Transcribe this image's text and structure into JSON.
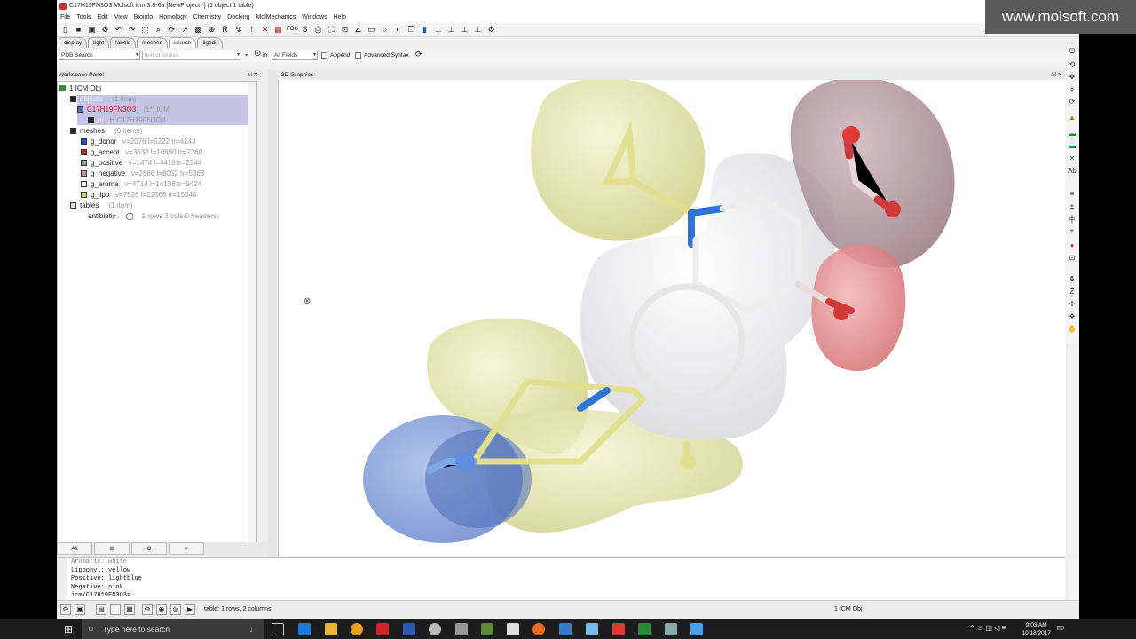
{
  "window": {
    "title": "C17H19FN3O3 Molsoft icm 3.8-6a [NewProject *] (1 object 1 table)",
    "watermark": "www.molsoft.com"
  },
  "menu": [
    "File",
    "Tools",
    "Edit",
    "View",
    "Bioinfo",
    "Homology",
    "Chemistry",
    "Docking",
    "MolMechanics",
    "Windows",
    "Help"
  ],
  "tabs": [
    "display",
    "light",
    "labels",
    "meshes",
    "search",
    "ligedit"
  ],
  "active_tab": "search",
  "search": {
    "database": "PDB Search",
    "placeholder": "text or smiles",
    "in_label": "in",
    "field": "All Fields",
    "append_label": "Append",
    "advanced_label": "Advanced Syntax"
  },
  "workspace": {
    "title": "Workspace Panel",
    "root": "1 ICM Obj",
    "objects_label": "objects",
    "objects_count": "(1 item)",
    "molecule": "C17H19FN3O3",
    "molecule_tag": "[1*] ICM",
    "chain": "m",
    "chain_tag": "H  C17H19FN3O3",
    "meshes_label": "meshes",
    "meshes_count": "(6 items)",
    "meshes": [
      {
        "name": "g_donor",
        "info": "v=2076 l=6222 tr=4148",
        "color": "#2a52be"
      },
      {
        "name": "g_accept",
        "info": "v=3632 l=10890 tr=7260",
        "color": "#d01c1c"
      },
      {
        "name": "g_positive",
        "info": "v=1474 l=4410 tr=2944",
        "color": "#8e9dc4"
      },
      {
        "name": "g_negative",
        "info": "v=2686 l=8052 tr=5368",
        "color": "#c48e9d"
      },
      {
        "name": "g_aroma",
        "info": "v=4714 l=14136 tr=9424",
        "color": "#ffffff"
      },
      {
        "name": "g_lipo",
        "info": "v=7526 l=22566 tr=15044",
        "color": "#d8d86a"
      }
    ],
    "tables_label": "tables",
    "tables_count": "(1 item)",
    "table_name": "antibiotic",
    "table_info": "1 rows 2 cols 0 headers",
    "bottom_tab": "All"
  },
  "graphics": {
    "title": "3D Graphics"
  },
  "console": {
    "lines": [
      "Aromatic: white",
      "Lipophyl: yellow",
      "Positive: lightblue",
      "Negative: pink",
      "icm/C17H19FN3O3> "
    ]
  },
  "status": {
    "left": "table: 1 rows, 2 columns",
    "right": "1 ICM Obj"
  },
  "taskbar": {
    "search_placeholder": "Type here to search",
    "time": "9:03 AM",
    "date": "10/18/2017"
  }
}
